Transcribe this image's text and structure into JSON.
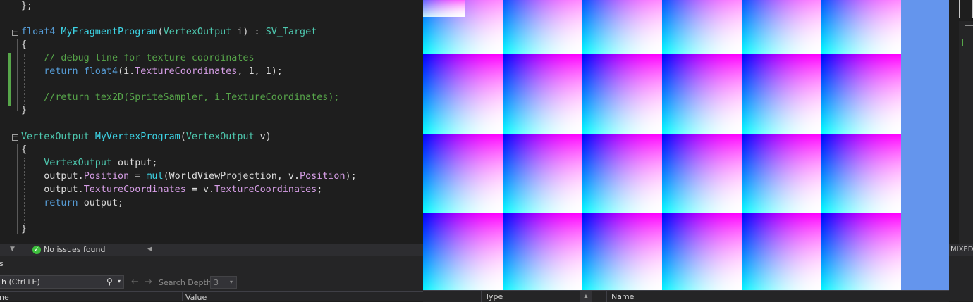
{
  "editor": {
    "lines": [
      {
        "tokens": [
          {
            "c": "pl",
            "t": "};"
          }
        ]
      },
      {
        "tokens": [
          {
            "c": "kw",
            "t": "float4 "
          },
          {
            "c": "fnm",
            "t": "MyFragmentProgram"
          },
          {
            "c": "pl",
            "t": "("
          },
          {
            "c": "fn",
            "t": "VertexOutput"
          },
          {
            "c": "pl",
            "t": " i) : "
          },
          {
            "c": "sem",
            "t": "SV_Target"
          }
        ]
      },
      {
        "tokens": [
          {
            "c": "pl",
            "t": "{"
          }
        ]
      },
      {
        "tokens": [
          {
            "c": "cm",
            "t": "    // debug line for texture coordinates"
          }
        ]
      },
      {
        "tokens": [
          {
            "c": "kw",
            "t": "    return "
          },
          {
            "c": "kw",
            "t": "float4"
          },
          {
            "c": "pl",
            "t": "(i."
          },
          {
            "c": "mem",
            "t": "TextureCoordinates"
          },
          {
            "c": "pl",
            "t": ", 1, 1);"
          }
        ]
      },
      {
        "tokens": [
          {
            "c": "cm",
            "t": "    //return tex2D(SpriteSampler, i.TextureCoordinates);"
          }
        ]
      },
      {
        "tokens": [
          {
            "c": "pl",
            "t": "}"
          }
        ]
      },
      {
        "tokens": [
          {
            "c": "fn",
            "t": "VertexOutput "
          },
          {
            "c": "fnm",
            "t": "MyVertexProgram"
          },
          {
            "c": "pl",
            "t": "("
          },
          {
            "c": "fn",
            "t": "VertexOutput"
          },
          {
            "c": "pl",
            "t": " v)"
          }
        ]
      },
      {
        "tokens": [
          {
            "c": "pl",
            "t": "{"
          }
        ]
      },
      {
        "tokens": [
          {
            "c": "fn",
            "t": "    VertexOutput"
          },
          {
            "c": "pl",
            "t": " output;"
          }
        ]
      },
      {
        "tokens": [
          {
            "c": "pl",
            "t": "    output."
          },
          {
            "c": "mem",
            "t": "Position"
          },
          {
            "c": "pl",
            "t": " = "
          },
          {
            "c": "fnm",
            "t": "mul"
          },
          {
            "c": "pl",
            "t": "(WorldViewProjection, v."
          },
          {
            "c": "mem",
            "t": "Position"
          },
          {
            "c": "pl",
            "t": ");"
          }
        ]
      },
      {
        "tokens": [
          {
            "c": "pl",
            "t": "    output."
          },
          {
            "c": "mem",
            "t": "TextureCoordinates"
          },
          {
            "c": "pl",
            "t": " = v."
          },
          {
            "c": "mem",
            "t": "TextureCoordinates"
          },
          {
            "c": "pl",
            "t": ";"
          }
        ]
      },
      {
        "tokens": [
          {
            "c": "kw",
            "t": "    return "
          },
          {
            "c": "pl",
            "t": "output;"
          }
        ]
      },
      {
        "tokens": [
          {
            "c": "pl",
            "t": "}"
          }
        ]
      }
    ],
    "fold_glyph": "−"
  },
  "status": {
    "issues_icon": "check-circle-icon",
    "issues_check": "✓",
    "issues_text": "No issues found",
    "left_arrow": "◀",
    "down_arrow": "▼"
  },
  "toolwin": {
    "title_fragment": "s",
    "search_placeholder": "h (Ctrl+E)",
    "search_icon": "⚲",
    "dropdown_glyph": "▾",
    "back_glyph": "←",
    "forward_glyph": "→",
    "search_depth_label": "Search Depth:",
    "search_depth_value": "3",
    "columns": {
      "name": "ne",
      "value": "Value",
      "type": "Type",
      "name2": "Name"
    },
    "sort_glyph": "▲"
  },
  "side": {
    "mixed_label": "MIXED"
  },
  "colors": {
    "preview_background": "#6495ed",
    "editor_background": "#1e1e1e",
    "change_marker": "#57a64a"
  }
}
